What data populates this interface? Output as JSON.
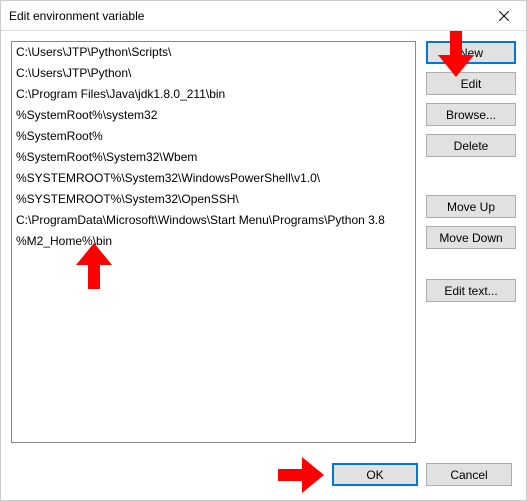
{
  "titlebar": {
    "title": "Edit environment variable"
  },
  "list": {
    "items": [
      "C:\\Users\\JTP\\Python\\Scripts\\",
      "C:\\Users\\JTP\\Python\\",
      "C:\\Program Files\\Java\\jdk1.8.0_211\\bin",
      "%SystemRoot%\\system32",
      "%SystemRoot%",
      "%SystemRoot%\\System32\\Wbem",
      "%SYSTEMROOT%\\System32\\WindowsPowerShell\\v1.0\\",
      "%SYSTEMROOT%\\System32\\OpenSSH\\",
      "C:\\ProgramData\\Microsoft\\Windows\\Start Menu\\Programs\\Python 3.8"
    ],
    "editing_value": "%M2_Home%\\bin"
  },
  "buttons": {
    "new": "New",
    "edit": "Edit",
    "browse": "Browse...",
    "delete": "Delete",
    "move_up": "Move Up",
    "move_down": "Move Down",
    "edit_text": "Edit text...",
    "ok": "OK",
    "cancel": "Cancel"
  }
}
